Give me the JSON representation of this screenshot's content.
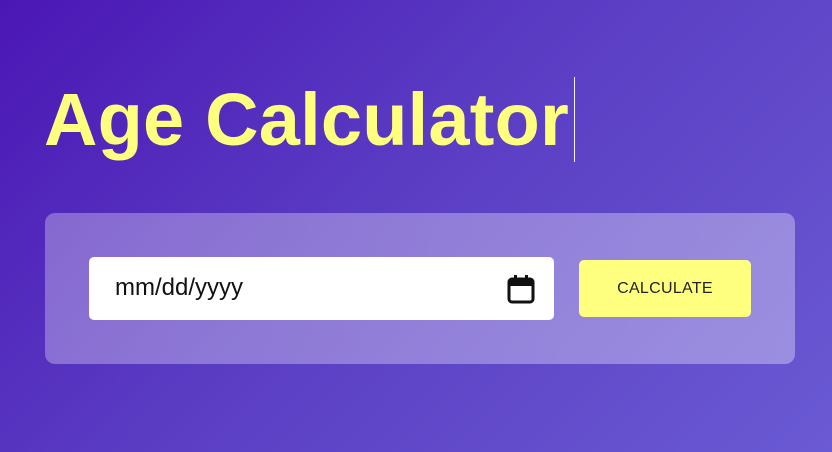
{
  "page": {
    "title": "Age Calculator"
  },
  "form": {
    "date_placeholder": "mm/dd/yyyy",
    "calculate_label": "CALCULATE",
    "calendar_icon": "calendar-icon"
  },
  "colors": {
    "accent": "#ffff7f",
    "background_start": "#4b16b5",
    "background_end": "#6a5ad3"
  }
}
